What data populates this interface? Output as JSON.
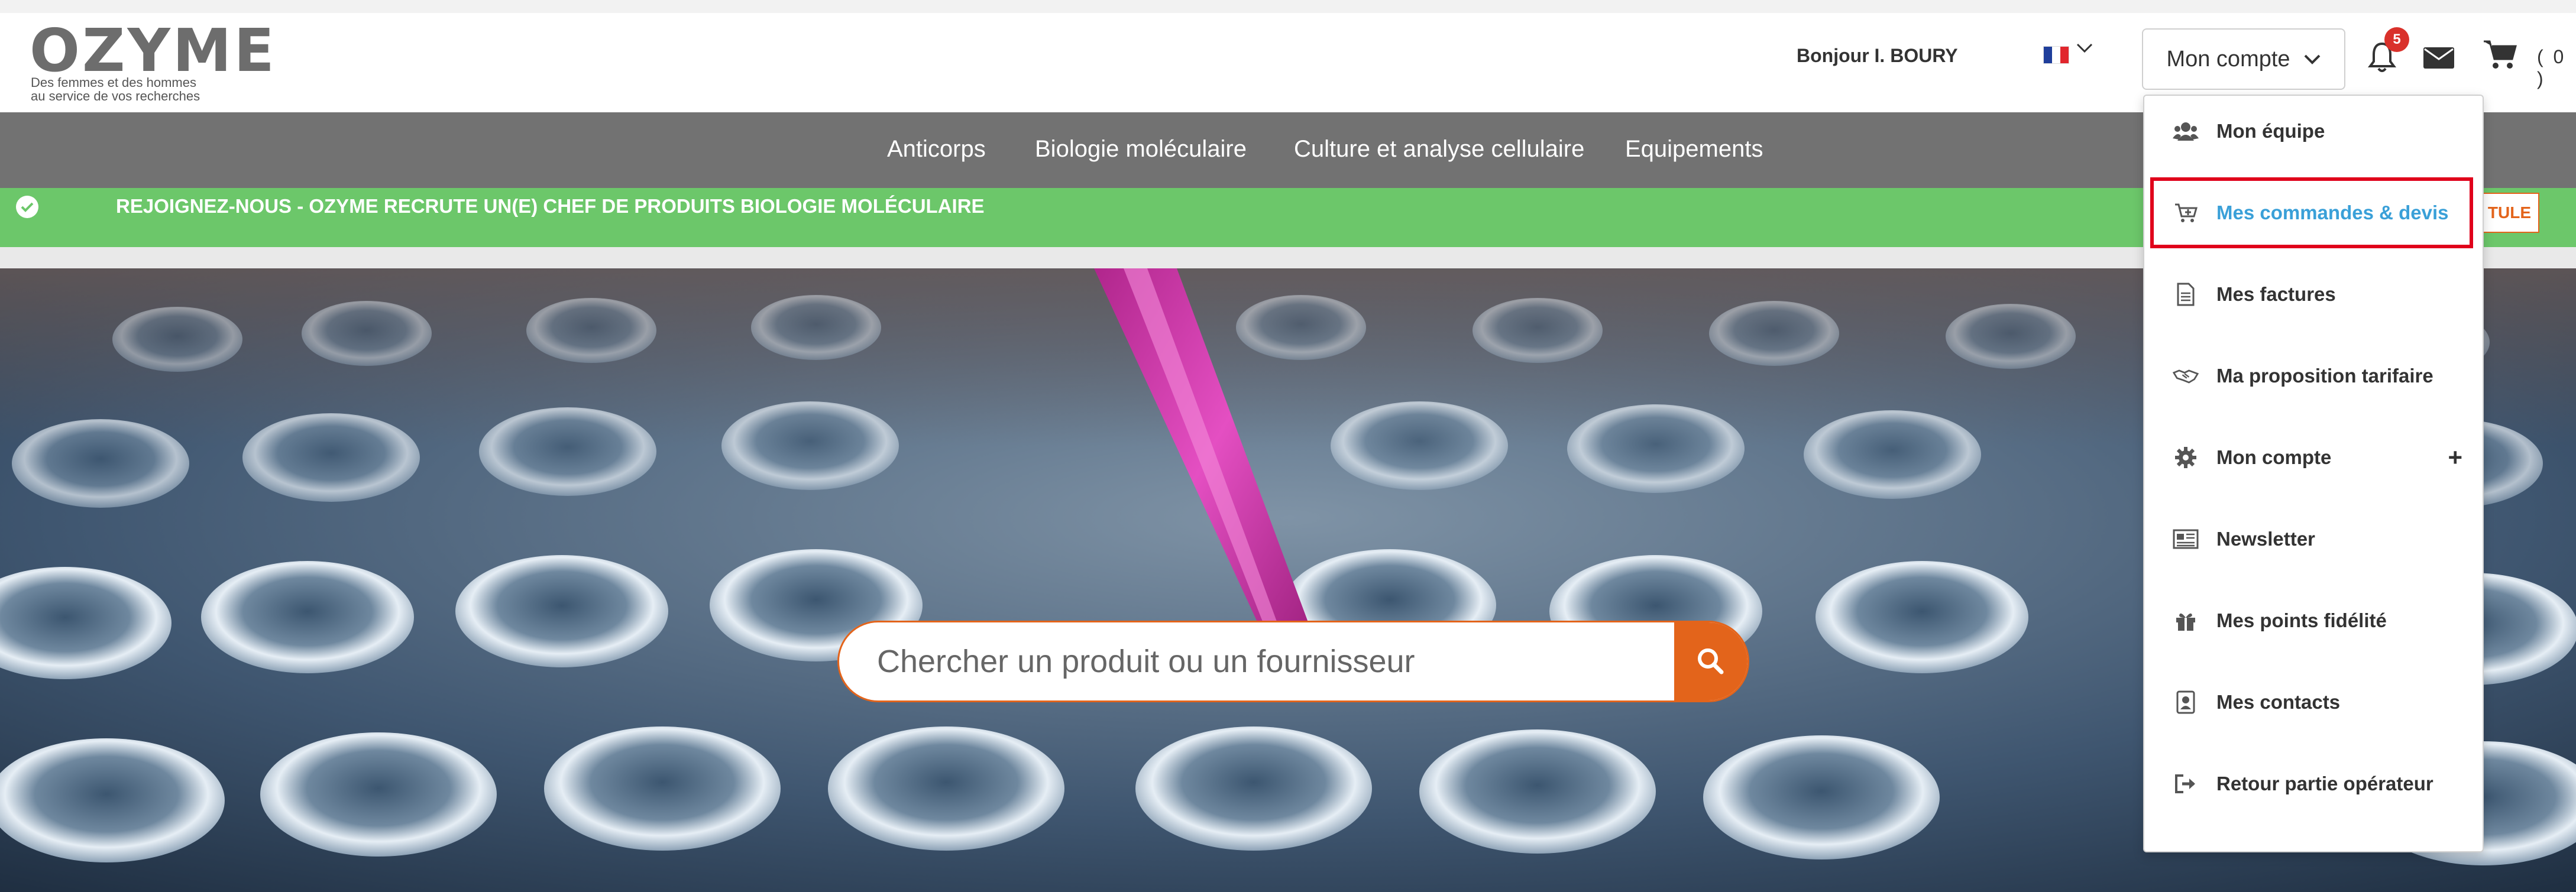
{
  "logo": {
    "name": "OZYME",
    "tagline_line1": "Des femmes et des hommes",
    "tagline_line2": "au service de vos recherches"
  },
  "header": {
    "greeting": "Bonjour I. BOURY",
    "account_button": "Mon compte",
    "notification_count": "5",
    "cart_count": "( 0 )"
  },
  "nav": {
    "items": [
      "Anticorps",
      "Biologie moléculaire",
      "Culture et analyse cellulaire",
      "Equipements"
    ]
  },
  "banner": {
    "text": "REJOIGNEZ-NOUS - OZYME RECRUTE UN(E) CHEF DE PRODUITS BIOLOGIE MOLÉCULAIRE",
    "button": "TULE"
  },
  "search": {
    "placeholder": "Chercher un produit ou un fournisseur"
  },
  "account_menu": {
    "items": [
      {
        "label": "Mon équipe",
        "icon": "users-icon"
      },
      {
        "label": "Mes commandes & devis",
        "icon": "cart-plus-icon",
        "active": true
      },
      {
        "label": "Mes factures",
        "icon": "document-icon"
      },
      {
        "label": "Ma proposition tarifaire",
        "icon": "handshake-icon"
      },
      {
        "label": "Mon compte",
        "icon": "gear-icon",
        "expandable": true
      },
      {
        "label": "Newsletter",
        "icon": "newspaper-icon"
      },
      {
        "label": "Mes points fidélité",
        "icon": "gift-icon"
      },
      {
        "label": "Mes contacts",
        "icon": "contact-book-icon"
      },
      {
        "label": "Retour partie opérateur",
        "icon": "sign-out-icon"
      }
    ],
    "expand_symbol": "+"
  },
  "colors": {
    "nav_bg": "#727272",
    "banner_bg": "#6cc76a",
    "accent_orange": "#e3641b",
    "active_link": "#3aa0d8",
    "highlight_red": "#e0001b"
  }
}
